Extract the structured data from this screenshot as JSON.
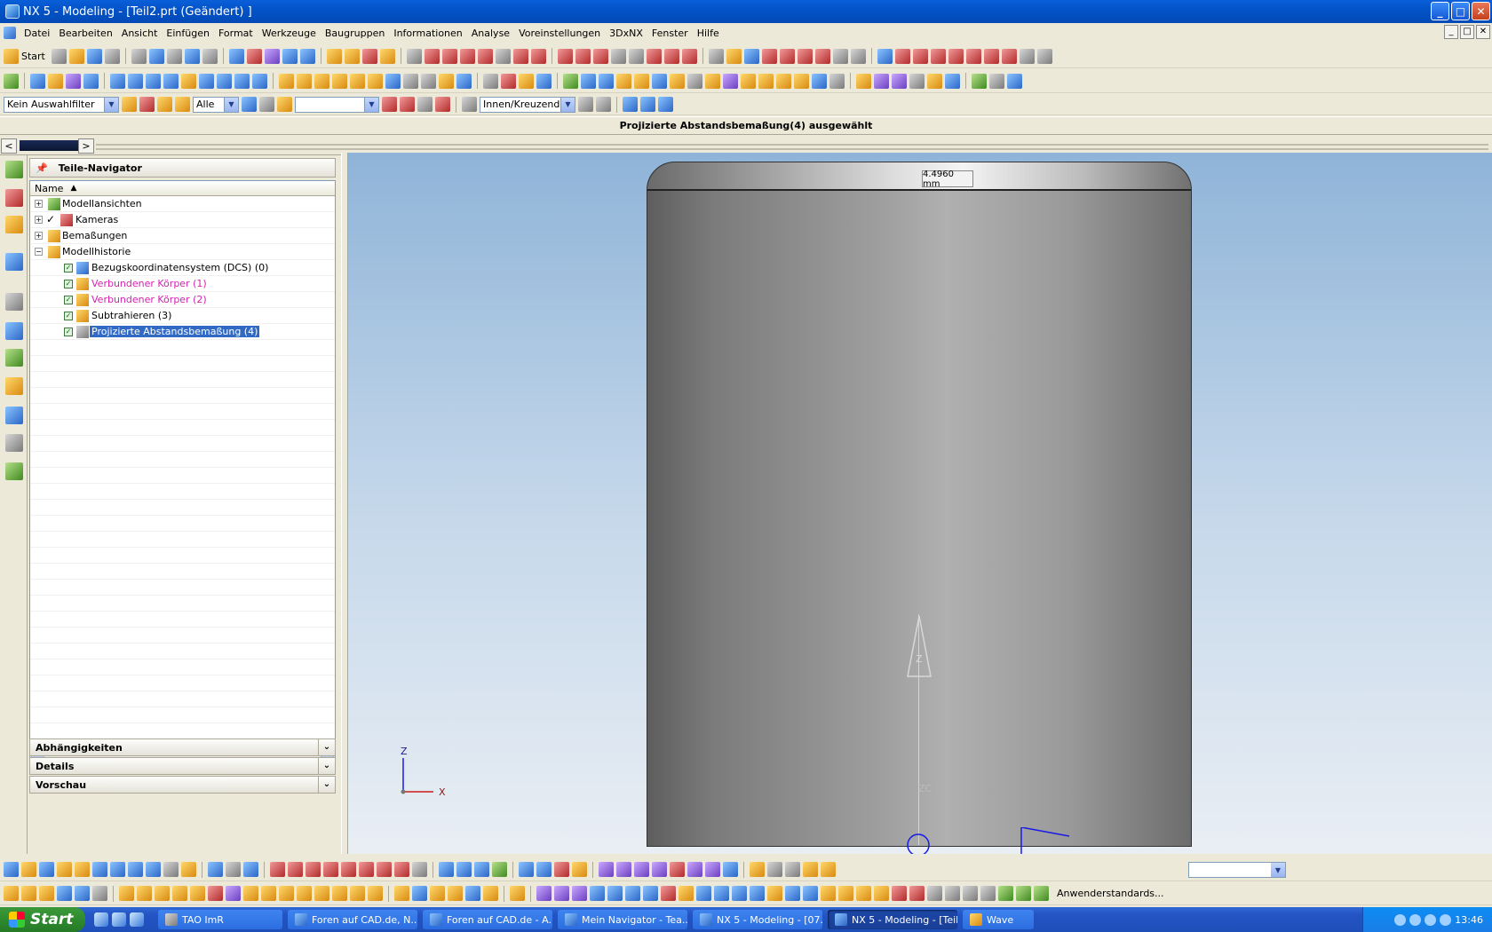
{
  "window": {
    "title": "NX 5 - Modeling - [Teil2.prt (Geändert) ]",
    "min": "_",
    "max": "□",
    "close": "✕"
  },
  "menu": [
    "Datei",
    "Bearbeiten",
    "Ansicht",
    "Einfügen",
    "Format",
    "Werkzeuge",
    "Baugruppen",
    "Informationen",
    "Analyse",
    "Voreinstellungen",
    "3DxNX",
    "Fenster",
    "Hilfe"
  ],
  "toolbar": {
    "start_label": "Start"
  },
  "filterbar": {
    "selection_filter": "Kein Auswahlfilter",
    "scope": "Alle",
    "blank": "",
    "mode": "Innen/Kreuzend"
  },
  "status": {
    "message": "Projizierte Abstandsbemaßung(4) ausgewählt"
  },
  "navigator": {
    "title": "Teile-Navigator",
    "column": "Name",
    "items": [
      {
        "label": "Modellansichten",
        "level": 0,
        "expander": "+"
      },
      {
        "label": "Kameras",
        "level": 0,
        "expander": "+",
        "check": "✓"
      },
      {
        "label": "Bemaßungen",
        "level": 0,
        "expander": "+"
      },
      {
        "label": "Modellhistorie",
        "level": 0,
        "expander": "−"
      },
      {
        "label": "Bezugskoordinatensystem (DCS) (0)",
        "level": 1
      },
      {
        "label": "Verbundener Körper (1)",
        "level": 1,
        "color": "#d321b2"
      },
      {
        "label": "Verbundener Körper (2)",
        "level": 1,
        "color": "#d321b2"
      },
      {
        "label": "Subtrahieren (3)",
        "level": 1
      },
      {
        "label": "Projizierte Abstandsbemaßung (4)",
        "level": 1,
        "selected": true
      }
    ],
    "sections": [
      "Abhängigkeiten",
      "Details",
      "Vorschau"
    ]
  },
  "viewport": {
    "dimension": "4.4960 mm",
    "axis_z": "Z",
    "axis_x": "X",
    "axis_zc": "ZC",
    "triad_z": "Z",
    "triad_x": "X"
  },
  "bottombar": {
    "role": "Anwenderstandards..."
  },
  "taskbar": {
    "start": "Start",
    "items": [
      {
        "label": "TAO ImR",
        "active": false
      },
      {
        "label": "Foren auf CAD.de, N...",
        "active": false
      },
      {
        "label": "Foren auf CAD.de - A...",
        "active": false
      },
      {
        "label": "Mein Navigator - Tea...",
        "active": false
      },
      {
        "label": "NX 5 - Modeling - [07...",
        "active": false
      },
      {
        "label": "NX 5 - Modeling - [Teil...",
        "active": true
      },
      {
        "label": "Wave",
        "active": false
      }
    ],
    "clock": "13:46"
  },
  "colors": {
    "selected": "#316ac5",
    "magenta": "#d321b2",
    "titlebar": "#0353c9"
  }
}
